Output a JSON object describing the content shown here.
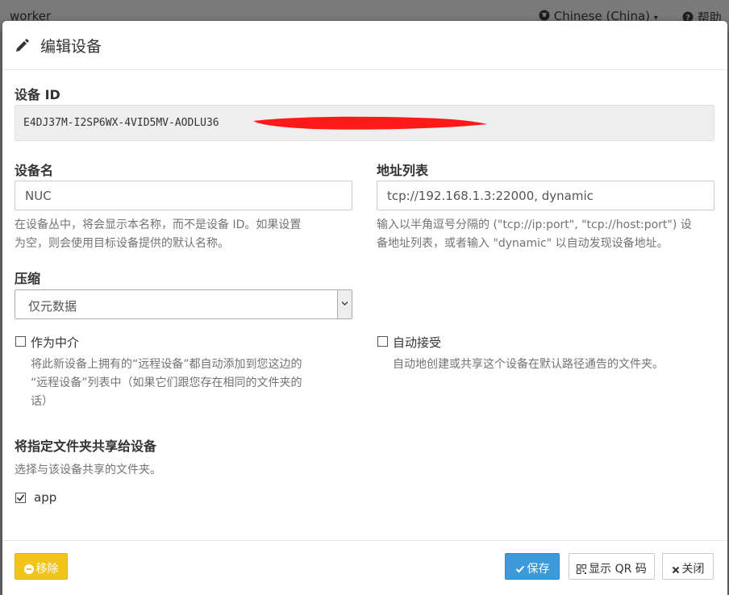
{
  "background": {
    "brand": "worker",
    "language": "Chinese (China)",
    "help": "帮助"
  },
  "dialog": {
    "title": "编辑设备",
    "device_id": {
      "label": "设备 ID",
      "value": "E4DJ37M-I2SP6WX-4VID5MV-AODLU36"
    },
    "device_name": {
      "label": "设备名",
      "value": "NUC",
      "help_line1": "在设备丛中，将会显示本名称，而不是设备 ID。如果设置",
      "help_line2": "为空，则会使用目标设备提供的默认名称。"
    },
    "addresses": {
      "label": "地址列表",
      "value": "tcp://192.168.1.3:22000, dynamic",
      "help_line1": "输入以半角逗号分隔的 (\"tcp://ip:port\", \"tcp://host:port\") 设",
      "help_line2": "备地址列表，或者输入 \"dynamic\" 以自动发现设备地址。"
    },
    "compression": {
      "label": "压缩",
      "value": "仅元数据"
    },
    "introducer": {
      "label": "作为中介",
      "checked": false,
      "help_line1": "将此新设备上拥有的“远程设备”都自动添加到您这边的",
      "help_line2": "“远程设备”列表中（如果它们跟您存在相同的文件夹的",
      "help_line3": "话）"
    },
    "auto_accept": {
      "label": "自动接受",
      "checked": false,
      "help": "自动地创建或共享这个设备在默认路径通告的文件夹。"
    },
    "share_folders": {
      "title": "将指定文件夹共享给设备",
      "help": "选择与该设备共享的文件夹。",
      "folders": [
        {
          "label": "app",
          "checked": true
        }
      ]
    },
    "footer": {
      "remove_label": "移除",
      "save_label": "保存",
      "qr_label": "显示 QR 码",
      "close_label": "关闭"
    }
  },
  "colors": {
    "warning": "#f0c419",
    "primary": "#3c9ad9",
    "redaction": "#ff1a1a"
  }
}
